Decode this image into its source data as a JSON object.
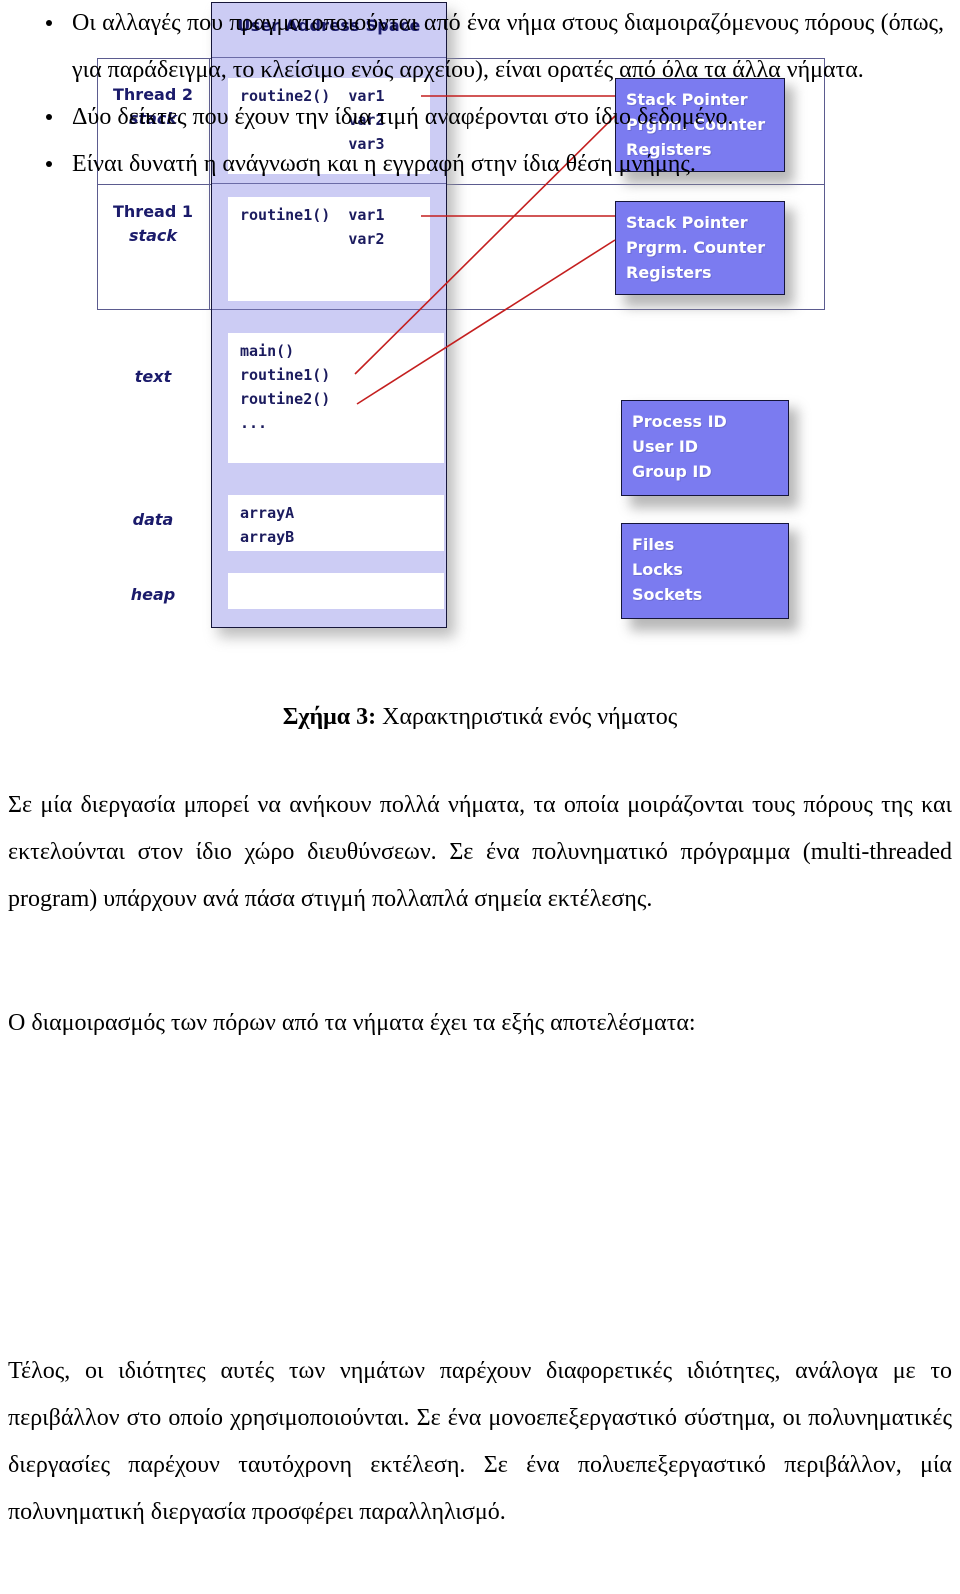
{
  "figure": {
    "title": "User Address Space",
    "regions": [
      {
        "name": "Thread 2",
        "sub": "stack"
      },
      {
        "name": "Thread 1",
        "sub": "stack"
      },
      {
        "name": "text",
        "sub": ""
      },
      {
        "name": "data",
        "sub": ""
      },
      {
        "name": "heap",
        "sub": ""
      }
    ],
    "panels": {
      "thread2_stack": "routine2()  var1\n            var2\n            var3",
      "thread1_stack": "routine1()  var1\n            var2",
      "text": "main()\nroutine1()\nroutine2()\n...",
      "data": "arrayA\narrayB",
      "heap": ""
    },
    "blue_boxes": [
      "Stack Pointer\nPrgrm. Counter\nRegisters",
      "Stack Pointer\nPrgrm. Counter\nRegisters",
      "Process ID\nUser ID\nGroup ID",
      "Files\nLocks\nSockets"
    ],
    "colors": {
      "address_space_fill": "#ccccf4",
      "blue_box_fill": "#7b7bf0",
      "label_text": "#1b1b6b",
      "connector_line": "#c41f1f",
      "frame_line": "#5b5b8f"
    }
  },
  "caption": {
    "label": "Σχήμα 3:",
    "text": " Χαρακτηριστικά ενός νήματος"
  },
  "body": {
    "paragraph1": "Σε μία διεργασία μπορεί να ανήκουν πολλά νήματα, τα οποία μοιράζονται τους πόρους της και εκτελούνται στον ίδιο χώρο διευθύνσεων.  Σε ένα πολυνηματικό πρόγραμμα (multi-threaded program) υπάρχουν ανά πάσα στιγμή πολλαπλά σημεία εκτέλεσης.",
    "lead_in": "Ο διαμοιρασμός των πόρων από τα νήματα έχει τα εξής αποτελέσματα:",
    "bullets": [
      "Οι αλλαγές που πραγματοποιούνται από ένα νήμα στους διαμοιραζόμενους πόρους (όπως, για παράδειγμα, το κλείσιμο ενός αρχείου), είναι ορατές από όλα τα άλλα νήματα.",
      "Δύο δείκτες που έχουν την ίδια τιμή αναφέρονται στο ίδιο δεδομένο.",
      "Είναι δυνατή η ανάγνωση και η εγγραφή στην ίδια θέση μνήμης."
    ],
    "paragraph2": "Τέλος, οι ιδιότητες αυτές των νημάτων παρέχουν διαφορετικές ιδιότητες, ανάλογα με το περιβάλλον στο οποίο χρησιμοποιούνται. Σε ένα μονοεπεξεργαστικό σύστημα, οι πολυνηματικές διεργασίες παρέχουν ταυτόχρονη εκτέλεση.  Σε ένα πολυεπεξεργαστικό περιβάλλον, μία πολυνηματική διεργασία προσφέρει παραλληλισμό."
  }
}
